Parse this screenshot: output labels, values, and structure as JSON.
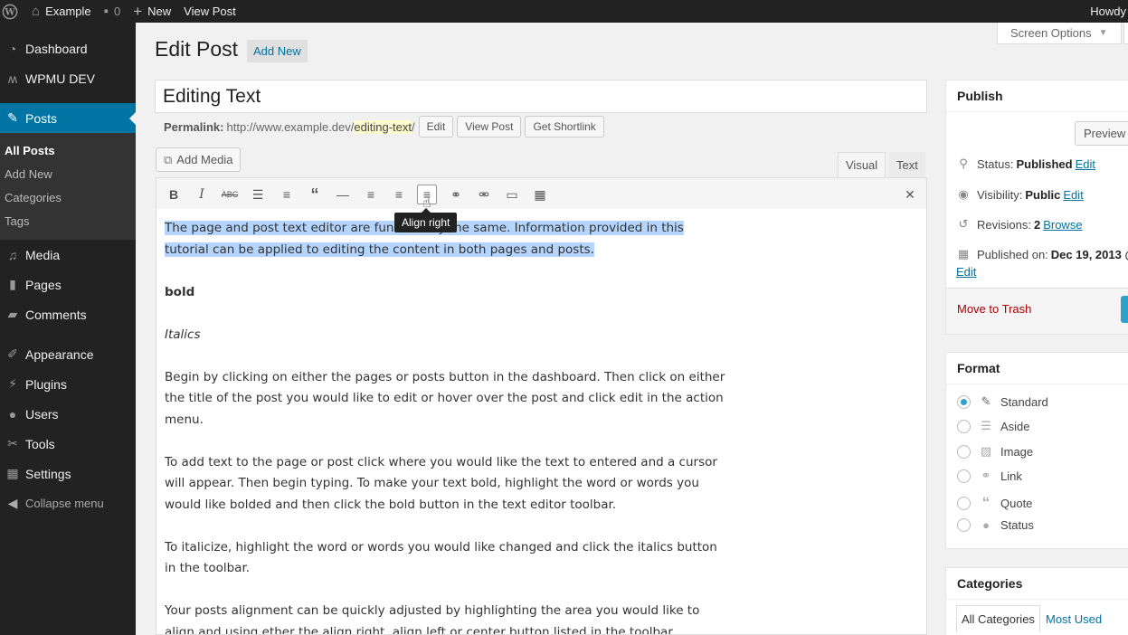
{
  "adminbar": {
    "site_name": "Example",
    "comments_count": "0",
    "new_label": "New",
    "view_post_label": "View Post",
    "howdy": "Howdy"
  },
  "sidebar": {
    "dashboard": "Dashboard",
    "wpmudev": "WPMU DEV",
    "posts": "Posts",
    "posts_submenu": [
      "All Posts",
      "Add New",
      "Categories",
      "Tags"
    ],
    "media": "Media",
    "pages": "Pages",
    "comments": "Comments",
    "appearance": "Appearance",
    "plugins": "Plugins",
    "users": "Users",
    "tools": "Tools",
    "settings": "Settings",
    "collapse": "Collapse menu"
  },
  "header": {
    "title": "Edit Post",
    "add_new": "Add New",
    "screen_options": "Screen Options"
  },
  "post": {
    "title": "Editing Text",
    "permalink_label": "Permalink:",
    "permalink_base": "http://www.example.dev/",
    "permalink_slug": "editing-text",
    "permalink_end": "/",
    "edit_btn": "Edit",
    "view_post_btn": "View Post",
    "shortlink_btn": "Get Shortlink"
  },
  "editor": {
    "add_media": "Add Media",
    "tab_visual": "Visual",
    "tab_text": "Text",
    "tooltip": "Align right",
    "para1": "The page and post text editor are functionally the same. Information provided in this tutorial can be applied to editing the content in both pages and posts.",
    "bold": "bold",
    "italics": "Italics",
    "para2": "Begin by clicking on either the pages or posts button in the dashboard. Then click on either the title of the post you would like to edit or hover over the post and click edit in the action menu.",
    "para3": "To add text to the page or post click where you would like the text to entered and a cursor will appear. Then begin typing. To make your text bold, highlight the word or words you would like bolded and then click the bold button in the text editor toolbar.",
    "para4": "To italicize, highlight the word or words you would like changed and click the italics button in the toolbar.",
    "para5": "Your posts alignment can be quickly adjusted by highlighting the area you would like to align and using ether the align right, align left or center button listed in the toolbar."
  },
  "publish": {
    "title": "Publish",
    "preview": "Preview",
    "status_label": "Status:",
    "status_value": "Published",
    "visibility_label": "Visibility:",
    "visibility_value": "Public",
    "revisions_label": "Revisions:",
    "revisions_value": "2",
    "browse": "Browse",
    "published_label": "Published on:",
    "published_value": "Dec 19, 2013 @",
    "edit": "Edit",
    "trash": "Move to Trash"
  },
  "format": {
    "title": "Format",
    "options": [
      "Standard",
      "Aside",
      "Image",
      "Link",
      "Quote",
      "Status"
    ],
    "selected": "Standard"
  },
  "categories": {
    "title": "Categories",
    "tab_all": "All Categories",
    "tab_used": "Most Used"
  },
  "icons": {
    "wp_logo": "wordpress-logo-icon",
    "home": "home-icon",
    "comment": "comment-bubble-icon",
    "plus": "plus-icon"
  },
  "colors": {
    "adminbar": "#222222",
    "accent": "#0074a2",
    "selection": "#b4d5fe",
    "trash": "#aa0000"
  }
}
